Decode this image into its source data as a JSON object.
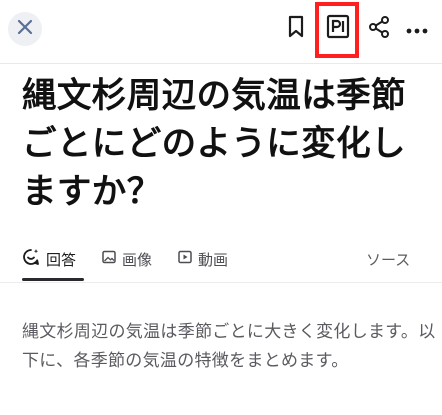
{
  "toolbar": {
    "close_icon": "close-icon",
    "bookmark_icon": "bookmark-icon",
    "reader_icon": "reader-view-icon",
    "share_icon": "share-icon",
    "more_icon": "more-icon",
    "highlight_color": "#ff1f1f"
  },
  "question": {
    "title": "縄文杉周辺の気温は季節ごとにどのように変化しますか？"
  },
  "tabs": [
    {
      "label": "回答",
      "icon": "sparkle-chat-icon",
      "active": true
    },
    {
      "label": "画像",
      "icon": "image-icon",
      "active": false
    },
    {
      "label": "動画",
      "icon": "play-icon",
      "active": false
    },
    {
      "label": "ソース",
      "active": false
    }
  ],
  "answer": {
    "text": "縄文杉周辺の気温は季節ごとに大きく変化します。以下に、各季節の気温の特徴をまとめます。"
  },
  "colors": {
    "accent_close": "#5a6f96",
    "text_primary": "#111111",
    "text_secondary": "#5a5a60"
  }
}
